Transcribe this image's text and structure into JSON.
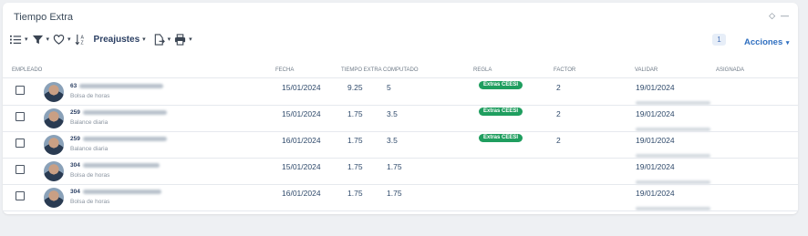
{
  "window": {
    "title": "Tiempo Extra",
    "controls": [
      "◇",
      "—"
    ]
  },
  "toolbar": {
    "list_icon": "list-icon",
    "filter_icon": "filter-icon",
    "favorite_icon": "heart-icon",
    "sort_icon": "sort-az-icon",
    "presets_label": "Preajustes",
    "export_icon": "export-icon",
    "print_icon": "printer-icon",
    "caret": "▾"
  },
  "selection_count": "1",
  "actions_label": "Acciones",
  "columns": {
    "employee": "Empleado",
    "date": "Fecha",
    "overtime": "Tiempo Extra",
    "computed": "Computado",
    "rule": "Regla",
    "factor": "Factor",
    "validate": "Validar",
    "assigned": "Asignada"
  },
  "rows": [
    {
      "emp_id": "63",
      "emp_sub": "Bolsa de horas",
      "date": "15/01/2024",
      "overtime": "9.25",
      "computed": "5",
      "rule": "Extras CEESI",
      "factor": "2",
      "validate_date": "19/01/2024"
    },
    {
      "emp_id": "259",
      "emp_sub": "Balance diaria",
      "date": "15/01/2024",
      "overtime": "1.75",
      "computed": "3.5",
      "rule": "Extras CEESI",
      "factor": "2",
      "validate_date": "19/01/2024"
    },
    {
      "emp_id": "259",
      "emp_sub": "Balance diaria",
      "date": "16/01/2024",
      "overtime": "1.75",
      "computed": "3.5",
      "rule": "Extras CEESI",
      "factor": "2",
      "validate_date": "19/01/2024"
    },
    {
      "emp_id": "304",
      "emp_sub": "Bolsa de horas",
      "date": "15/01/2024",
      "overtime": "1.75",
      "computed": "1.75",
      "rule": "",
      "factor": "",
      "validate_date": "19/01/2024"
    },
    {
      "emp_id": "304",
      "emp_sub": "Bolsa de horas",
      "date": "16/01/2024",
      "overtime": "1.75",
      "computed": "1.75",
      "rule": "",
      "factor": "",
      "validate_date": "19/01/2024"
    }
  ],
  "colors": {
    "rule_badge": "#1f9e5f",
    "accent": "#2f6fc0",
    "background": "#eef0f3"
  }
}
